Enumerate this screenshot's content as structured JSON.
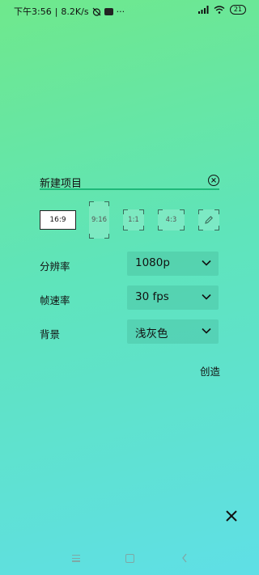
{
  "status_bar": {
    "time": "下午3:56",
    "net_speed": "8.2K/s",
    "more": "···",
    "battery": "21"
  },
  "project": {
    "name": "新建项目"
  },
  "aspect_ratios": [
    {
      "label": "16:9",
      "selected": true
    },
    {
      "label": "9:16",
      "selected": false
    },
    {
      "label": "1:1",
      "selected": false
    },
    {
      "label": "4:3",
      "selected": false
    },
    {
      "label": "custom",
      "icon": "pencil-icon",
      "selected": false
    }
  ],
  "settings": {
    "resolution": {
      "label": "分辨率",
      "value": "1080p"
    },
    "frame_rate": {
      "label": "帧速率",
      "value": "30 fps"
    },
    "background": {
      "label": "背景",
      "value": "浅灰色"
    }
  },
  "actions": {
    "create_label": "创造"
  },
  "colors": {
    "accent": "#1fb879",
    "gradient_top": "#6fe88c",
    "gradient_bottom": "#5fdfe6"
  }
}
